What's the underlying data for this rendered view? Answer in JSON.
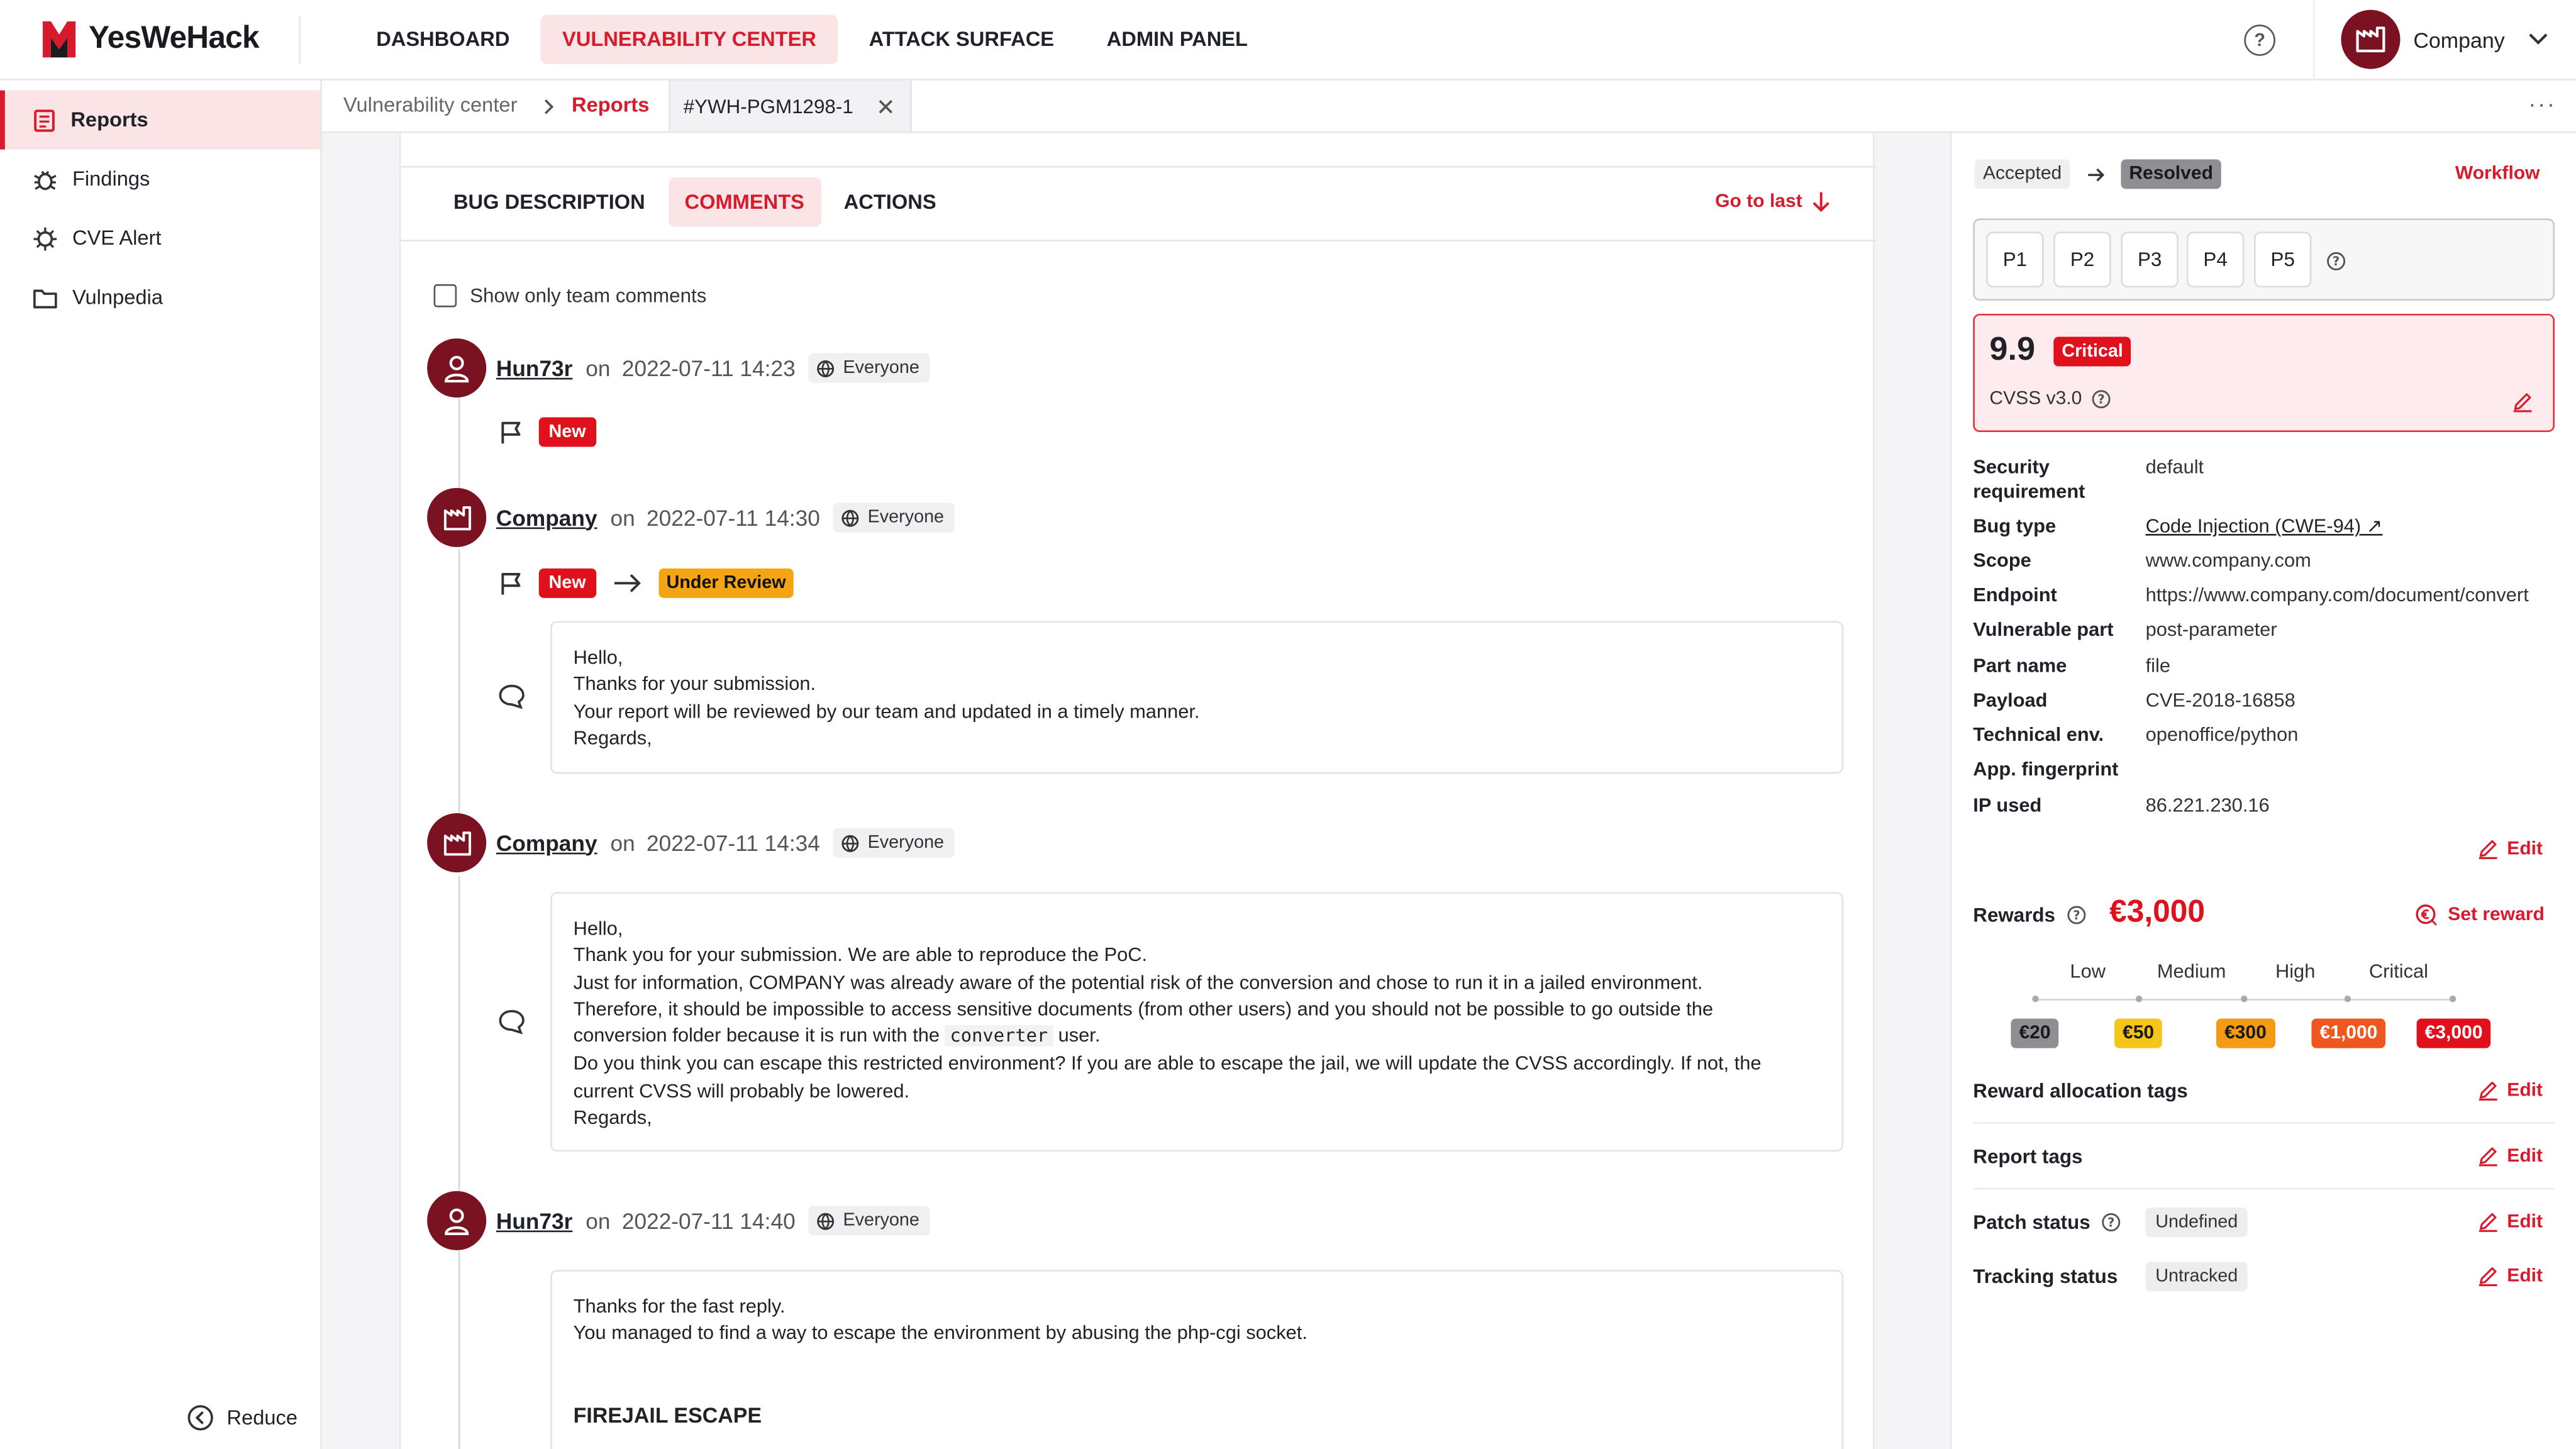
{
  "app": {
    "logo_text": "YesWeHack"
  },
  "nav": {
    "items": [
      "DASHBOARD",
      "VULNERABILITY CENTER",
      "ATTACK SURFACE",
      "ADMIN PANEL"
    ],
    "active": "VULNERABILITY CENTER"
  },
  "header": {
    "company_label": "Company"
  },
  "sidebar": {
    "items": [
      {
        "label": "Reports",
        "icon": "report-icon",
        "active": true
      },
      {
        "label": "Findings",
        "icon": "bug-icon",
        "active": false
      },
      {
        "label": "CVE Alert",
        "icon": "cve-alert-icon",
        "active": false
      },
      {
        "label": "Vulnpedia",
        "icon": "folder-icon",
        "active": false
      }
    ],
    "reduce_label": "Reduce"
  },
  "breadcrumb": {
    "items": [
      "Vulnerability center",
      "Reports"
    ],
    "tab_label": "#YWH-PGM1298-1"
  },
  "report_tabs": {
    "items": [
      "BUG DESCRIPTION",
      "COMMENTS",
      "ACTIONS"
    ],
    "active": "COMMENTS",
    "go_to_last": "Go to last"
  },
  "filter": {
    "show_team_only": "Show only team comments"
  },
  "comments": [
    {
      "user": "Hun73r",
      "on": "on",
      "date": "2022-07-11 14:23",
      "visibility": "Everyone",
      "status_from": "New"
    },
    {
      "user": "Company",
      "on": "on",
      "date": "2022-07-11 14:30",
      "visibility": "Everyone",
      "status_from": "New",
      "status_to": "Under Review",
      "lines": [
        "Hello,",
        "Thanks for your submission.",
        "Your report will be reviewed by our team and updated in a timely manner.",
        "Regards,"
      ]
    },
    {
      "user": "Company",
      "on": "on",
      "date": "2022-07-11 14:34",
      "visibility": "Everyone",
      "lines": [
        "Hello,",
        "Thank you for your submission. We are able to reproduce the PoC.",
        "Just for information, COMPANY was already aware of the potential risk of the conversion and chose to run it in a jailed environment.",
        "Therefore, it should be impossible to access sensitive documents (from other users) and you should not be possible to go outside the",
        "conversion folder because it is run with the",
        "converter",
        "user.",
        "Do you think you can escape this restricted environment? If you are able to escape the jail, we will update the CVSS accordingly. If not, the",
        "current CVSS will probably be lowered.",
        "Regards,"
      ]
    },
    {
      "user": "Hun73r",
      "on": "on",
      "date": "2022-07-11 14:40",
      "visibility": "Everyone",
      "lines": [
        "Thanks for the fast reply.",
        "You managed to find a way to escape the environment by abusing the php-cgi socket."
      ],
      "heading": "FIREJAIL ESCAPE"
    }
  ],
  "right_panel": {
    "workflow": {
      "from": "Accepted",
      "to": "Resolved",
      "link": "Workflow"
    },
    "priorities": [
      "P1",
      "P2",
      "P3",
      "P4",
      "P5"
    ],
    "cvss": {
      "score": "9.9",
      "severity": "Critical",
      "version": "CVSS v3.0"
    },
    "details": [
      {
        "key": "Security requirement",
        "value": "default"
      },
      {
        "key": "Bug type",
        "value": "Code Injection (CWE-94) ↗"
      },
      {
        "key": "Scope",
        "value": "www.company.com"
      },
      {
        "key": "Endpoint",
        "value": "https://www.company.com/document/convert"
      },
      {
        "key": "Vulnerable part",
        "value": "post-parameter"
      },
      {
        "key": "Part name",
        "value": "file"
      },
      {
        "key": "Payload",
        "value": "CVE-2018-16858"
      },
      {
        "key": "Technical env.",
        "value": "openoffice/python"
      },
      {
        "key": "App. fingerprint",
        "value": ""
      },
      {
        "key": "IP used",
        "value": "86.221.230.16"
      }
    ],
    "edit_label": "Edit",
    "rewards": {
      "label": "Rewards",
      "amount": "€3,000",
      "set_reward": "Set reward",
      "levels": [
        "Low",
        "Medium",
        "High",
        "Critical"
      ],
      "chips": [
        {
          "label": "€20",
          "color": "#8e8e93"
        },
        {
          "label": "€50",
          "color": "#f5c518"
        },
        {
          "label": "€300",
          "color": "#f59a14"
        },
        {
          "label": "€1,000",
          "color": "#f0571e"
        },
        {
          "label": "€3,000",
          "color": "#e0111c"
        }
      ]
    },
    "reward_allocation_tags": "Reward allocation tags",
    "report_tags": "Report tags",
    "patch_status": {
      "label": "Patch status",
      "value": "Undefined"
    },
    "tracking_status": {
      "label": "Tracking status",
      "value": "Untracked"
    }
  },
  "colors": {
    "accent": "#d81b2c",
    "accent_bg": "#fbe4e6",
    "company_avatar": "#7a1222"
  }
}
